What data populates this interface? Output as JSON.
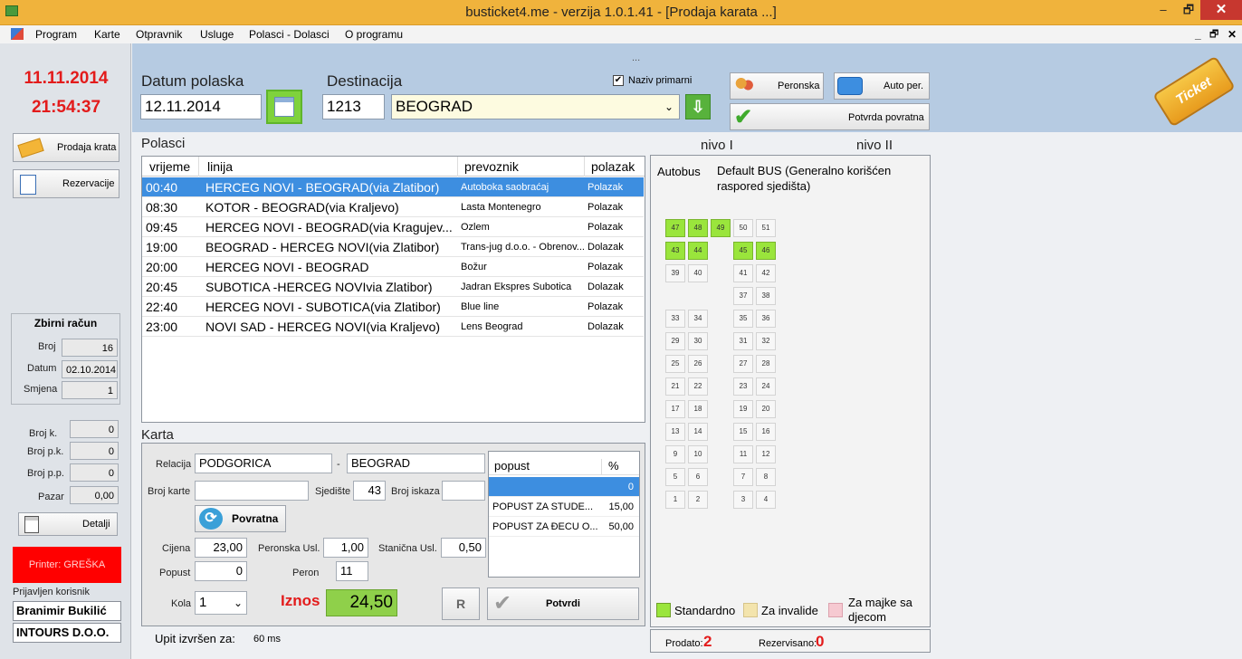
{
  "window": {
    "title": "busticket4.me - verzija 1.0.1.41 - [Prodaja karata ...]",
    "minimize": "–",
    "restore": "🗗",
    "close": "✕"
  },
  "menu": {
    "items": [
      "Program",
      "Karte",
      "Otpravnik",
      "Usluge",
      "Polasci - Dolasci",
      "O programu"
    ],
    "mdi_min": "_",
    "mdi_restore": "🗗",
    "mdi_close": "✕"
  },
  "clock": {
    "date": "11.11.2014",
    "time": "21:54:37"
  },
  "left_nav": {
    "prodaja": "Prodaja krata",
    "rezervacije": "Rezervacije"
  },
  "zbirni": {
    "title": "Zbirni račun",
    "broj_label": "Broj",
    "broj": "16",
    "datum_label": "Datum",
    "datum": "02.10.2014",
    "smjena_label": "Smjena",
    "smjena": "1"
  },
  "counts": {
    "brojk_label": "Broj k.",
    "brojk": "0",
    "brojpk_label": "Broj p.k.",
    "brojpk": "0",
    "brojpp_label": "Broj p.p.",
    "brojpp": "0",
    "pazar_label": "Pazar",
    "pazar": "0,00",
    "detalji": "Detalji"
  },
  "printer": "Printer: GREŠKA",
  "user": {
    "label": "Prijavljen korisnik",
    "name": "Branimir Bukilić",
    "company": "INTOURS D.O.O."
  },
  "header": {
    "dots": "...",
    "datum_label": "Datum polaska",
    "datum": "12.11.2014",
    "dest_label": "Destinacija",
    "dest_code": "1213",
    "dest_name": "BEOGRAD",
    "naziv_label": "Naziv primarni",
    "peronska": "Peronska",
    "auto_per": "Auto per.",
    "potvrda_povratna": "Potvrda povratna",
    "ticket_logo": "Ticket"
  },
  "polasci": {
    "title": "Polasci",
    "headers": [
      "vrijeme",
      "linija",
      "prevoznik",
      "polazak"
    ],
    "rows": [
      {
        "time": "00:40",
        "line": "HERCEG NOVI - BEOGRAD(via Zlatibor)",
        "carrier": "Autoboka saobraćaj",
        "dir": "Polazak"
      },
      {
        "time": "08:30",
        "line": "KOTOR - BEOGRAD(via Kraljevo)",
        "carrier": "Lasta Montenegro",
        "dir": "Polazak"
      },
      {
        "time": "09:45",
        "line": "HERCEG NOVI - BEOGRAD(via Kragujev...",
        "carrier": "Ozlem",
        "dir": "Polazak"
      },
      {
        "time": "19:00",
        "line": "BEOGRAD - HERCEG NOVI(via Zlatibor)",
        "carrier": "Trans-jug d.o.o. - Obrenov...",
        "dir": "Dolazak"
      },
      {
        "time": "20:00",
        "line": "HERCEG NOVI - BEOGRAD",
        "carrier": "Božur",
        "dir": "Polazak"
      },
      {
        "time": "20:45",
        "line": "SUBOTICA -HERCEG NOVIvia Zlatibor)",
        "carrier": "Jadran Ekspres Subotica",
        "dir": "Dolazak"
      },
      {
        "time": "22:40",
        "line": "HERCEG NOVI - SUBOTICA(via Zlatibor)",
        "carrier": "Blue line",
        "dir": "Polazak"
      },
      {
        "time": "23:00",
        "line": "NOVI SAD - HERCEG NOVI(via Kraljevo)",
        "carrier": "Lens Beograd",
        "dir": "Dolazak"
      }
    ]
  },
  "karta": {
    "title": "Karta",
    "relacija_label": "Relacija",
    "from": "PODGORICA",
    "dash": "-",
    "to": "BEOGRAD",
    "broj_karte_label": "Broj karte",
    "broj_karte": "",
    "sjediste_label": "Sjedište",
    "sjediste": "43",
    "broj_iskaza_label": "Broj iskaza",
    "broj_iskaza": "",
    "povratna": "Povratna",
    "cijena_label": "Cijena",
    "cijena": "23,00",
    "peronska_label": "Peronska Usl.",
    "peronska": "1,00",
    "stanicna_label": "Stanična Usl.",
    "stanicna": "0,50",
    "popust_label": "Popust",
    "popust": "0",
    "peron_label": "Peron",
    "peron": "11",
    "kola_label": "Kola",
    "kola": "1",
    "iznos_label": "Iznos",
    "iznos": "24,50",
    "r_btn": "R",
    "potvrdi": "Potvrdi"
  },
  "popust": {
    "headers": [
      "popust",
      "%"
    ],
    "rows": [
      {
        "name": "",
        "pct": "0"
      },
      {
        "name": "POPUST ZA STUDE...",
        "pct": "15,00"
      },
      {
        "name": "POPUST ZA ĐECU O...",
        "pct": "50,00"
      }
    ]
  },
  "status": {
    "upit_label": "Upit izvršen za:",
    "upit": "60 ms"
  },
  "bus": {
    "nivo1": "nivo I",
    "nivo2": "nivo II",
    "label": "Autobus",
    "desc": "Default BUS (Generalno korišćen raspored sjedišta)",
    "seats": [
      {
        "n": "47",
        "c": 0,
        "r": 0,
        "occ": true
      },
      {
        "n": "48",
        "c": 1,
        "r": 0,
        "occ": true
      },
      {
        "n": "49",
        "c": 2,
        "r": 0,
        "occ": true
      },
      {
        "n": "50",
        "c": 3,
        "r": 0,
        "occ": false
      },
      {
        "n": "51",
        "c": 4,
        "r": 0,
        "occ": false
      },
      {
        "n": "43",
        "c": 0,
        "r": 1,
        "occ": true
      },
      {
        "n": "44",
        "c": 1,
        "r": 1,
        "occ": true
      },
      {
        "n": "45",
        "c": 3,
        "r": 1,
        "occ": true
      },
      {
        "n": "46",
        "c": 4,
        "r": 1,
        "occ": true
      },
      {
        "n": "39",
        "c": 0,
        "r": 2,
        "occ": false
      },
      {
        "n": "40",
        "c": 1,
        "r": 2,
        "occ": false
      },
      {
        "n": "41",
        "c": 3,
        "r": 2,
        "occ": false
      },
      {
        "n": "42",
        "c": 4,
        "r": 2,
        "occ": false
      },
      {
        "n": "37",
        "c": 3,
        "r": 3,
        "occ": false
      },
      {
        "n": "38",
        "c": 4,
        "r": 3,
        "occ": false
      },
      {
        "n": "33",
        "c": 0,
        "r": 4,
        "occ": false
      },
      {
        "n": "34",
        "c": 1,
        "r": 4,
        "occ": false
      },
      {
        "n": "35",
        "c": 3,
        "r": 4,
        "occ": false
      },
      {
        "n": "36",
        "c": 4,
        "r": 4,
        "occ": false
      },
      {
        "n": "29",
        "c": 0,
        "r": 5,
        "occ": false
      },
      {
        "n": "30",
        "c": 1,
        "r": 5,
        "occ": false
      },
      {
        "n": "31",
        "c": 3,
        "r": 5,
        "occ": false
      },
      {
        "n": "32",
        "c": 4,
        "r": 5,
        "occ": false
      },
      {
        "n": "25",
        "c": 0,
        "r": 6,
        "occ": false
      },
      {
        "n": "26",
        "c": 1,
        "r": 6,
        "occ": false
      },
      {
        "n": "27",
        "c": 3,
        "r": 6,
        "occ": false
      },
      {
        "n": "28",
        "c": 4,
        "r": 6,
        "occ": false
      },
      {
        "n": "21",
        "c": 0,
        "r": 7,
        "occ": false
      },
      {
        "n": "22",
        "c": 1,
        "r": 7,
        "occ": false
      },
      {
        "n": "23",
        "c": 3,
        "r": 7,
        "occ": false
      },
      {
        "n": "24",
        "c": 4,
        "r": 7,
        "occ": false
      },
      {
        "n": "17",
        "c": 0,
        "r": 8,
        "occ": false
      },
      {
        "n": "18",
        "c": 1,
        "r": 8,
        "occ": false
      },
      {
        "n": "19",
        "c": 3,
        "r": 8,
        "occ": false
      },
      {
        "n": "20",
        "c": 4,
        "r": 8,
        "occ": false
      },
      {
        "n": "13",
        "c": 0,
        "r": 9,
        "occ": false
      },
      {
        "n": "14",
        "c": 1,
        "r": 9,
        "occ": false
      },
      {
        "n": "15",
        "c": 3,
        "r": 9,
        "occ": false
      },
      {
        "n": "16",
        "c": 4,
        "r": 9,
        "occ": false
      },
      {
        "n": "9",
        "c": 0,
        "r": 10,
        "occ": false
      },
      {
        "n": "10",
        "c": 1,
        "r": 10,
        "occ": false
      },
      {
        "n": "11",
        "c": 3,
        "r": 10,
        "occ": false
      },
      {
        "n": "12",
        "c": 4,
        "r": 10,
        "occ": false
      },
      {
        "n": "5",
        "c": 0,
        "r": 11,
        "occ": false
      },
      {
        "n": "6",
        "c": 1,
        "r": 11,
        "occ": false
      },
      {
        "n": "7",
        "c": 3,
        "r": 11,
        "occ": false
      },
      {
        "n": "8",
        "c": 4,
        "r": 11,
        "occ": false
      },
      {
        "n": "1",
        "c": 0,
        "r": 12,
        "occ": false
      },
      {
        "n": "2",
        "c": 1,
        "r": 12,
        "occ": false
      },
      {
        "n": "3",
        "c": 3,
        "r": 12,
        "occ": false
      },
      {
        "n": "4",
        "c": 4,
        "r": 12,
        "occ": false
      }
    ],
    "legend": {
      "standard": "Standardno",
      "invalid": "Za invalide",
      "mothers": "Za majke sa djecom"
    },
    "prodato_label": "Prodato:",
    "prodato": "2",
    "rezervisano_label": "Rezervisano:",
    "rezervisano": "0"
  },
  "colors": {
    "occupied": "#9ae53c",
    "invalid": "#f3e4ad",
    "mothers": "#f6c9d1",
    "red": "#e31b1b"
  }
}
